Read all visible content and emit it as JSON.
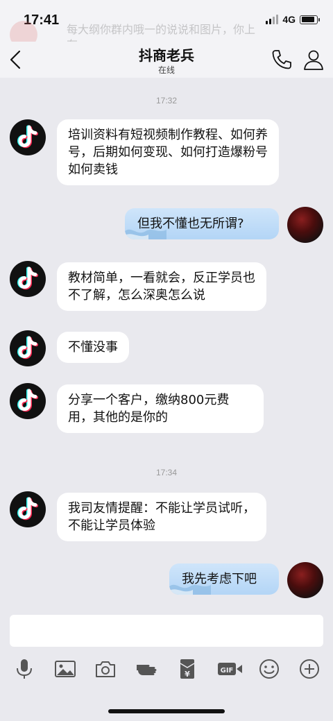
{
  "status_bar": {
    "time": "17:41",
    "network": "4G"
  },
  "notification_ghost": {
    "text": "每大纲你群内哦一的说说和图片，你上存"
  },
  "header": {
    "title": "抖商老兵",
    "subtitle": "在线"
  },
  "messages": [
    {
      "time": "17:32"
    },
    {
      "side": "in",
      "text": "培训资料有短视频制作教程、如何养号，后期如何变现、如何打造爆粉号如何卖钱"
    },
    {
      "side": "out",
      "text": "但我不懂也无所谓?"
    },
    {
      "side": "in",
      "text": "教材简单，一看就会，反正学员也不了解，怎么深奥怎么说"
    },
    {
      "side": "in",
      "text": "不懂没事"
    },
    {
      "side": "in",
      "text": "分享一个客户，缴纳800元费用，其他的是你的"
    },
    {
      "time": "17:34"
    },
    {
      "side": "in",
      "text": "我司友情提醒：不能让学员试听，不能让学员体验"
    },
    {
      "side": "out",
      "text": "我先考虑下吧"
    }
  ],
  "input": {
    "placeholder": ""
  },
  "toolbar": {
    "items": [
      "microphone-icon",
      "image-icon",
      "camera-icon",
      "poke-icon",
      "red-packet-icon",
      "gif-icon",
      "emoji-icon",
      "plus-icon"
    ],
    "red_packet_symbol": "¥",
    "gif_label": "GIF"
  },
  "colors": {
    "background": "#e9e9ee",
    "bubble_in": "#ffffff",
    "bubble_out": "#b3d5f6",
    "text": "#111111"
  }
}
